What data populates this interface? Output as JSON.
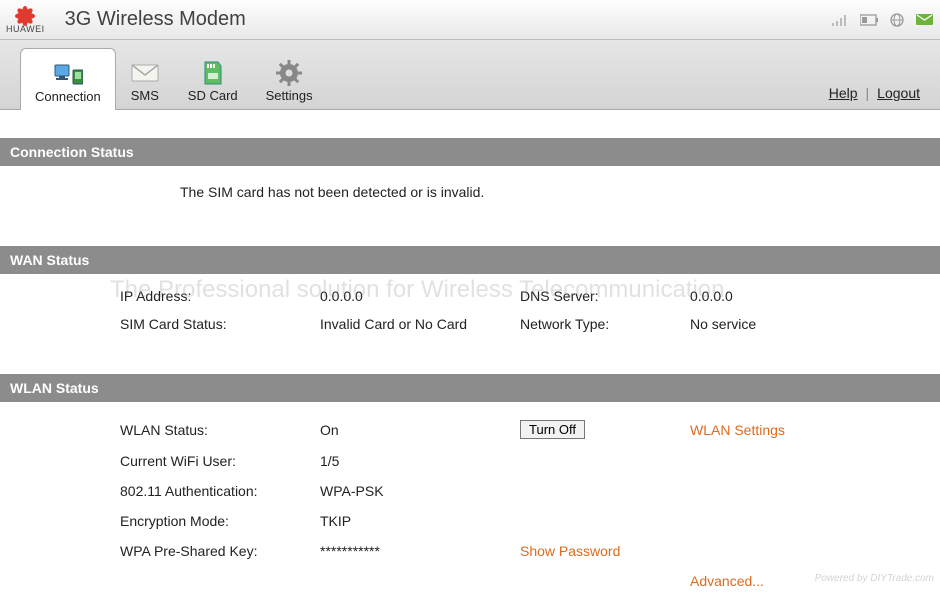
{
  "header": {
    "brand": "HUAWEI",
    "title": "3G Wireless Modem"
  },
  "tabs": {
    "connection": "Connection",
    "sms": "SMS",
    "sdcard": "SD Card",
    "settings": "Settings"
  },
  "links": {
    "help": "Help",
    "logout": "Logout"
  },
  "connection_status": {
    "heading": "Connection Status",
    "message": "The SIM card has not been detected or is invalid."
  },
  "wan_status": {
    "heading": "WAN Status",
    "ip_label": "IP Address:",
    "ip_value": "0.0.0.0",
    "dns_label": "DNS Server:",
    "dns_value": "0.0.0.0",
    "sim_label": "SIM Card Status:",
    "sim_value": "Invalid Card or No Card",
    "net_label": "Network Type:",
    "net_value": "No service"
  },
  "wlan_status": {
    "heading": "WLAN Status",
    "status_label": "WLAN Status:",
    "status_value": "On",
    "turn_off": "Turn Off",
    "settings_link": "WLAN Settings",
    "user_label": "Current WiFi User:",
    "user_value": "1/5",
    "auth_label": "802.11 Authentication:",
    "auth_value": "WPA-PSK",
    "enc_label": "Encryption Mode:",
    "enc_value": "TKIP",
    "psk_label": "WPA Pre-Shared Key:",
    "psk_value": "***********",
    "show_password": "Show Password",
    "advanced": "Advanced..."
  },
  "watermark": "The Professional solution for Wireless Telecommunication",
  "powered": "Powered by DIYTrade.com"
}
